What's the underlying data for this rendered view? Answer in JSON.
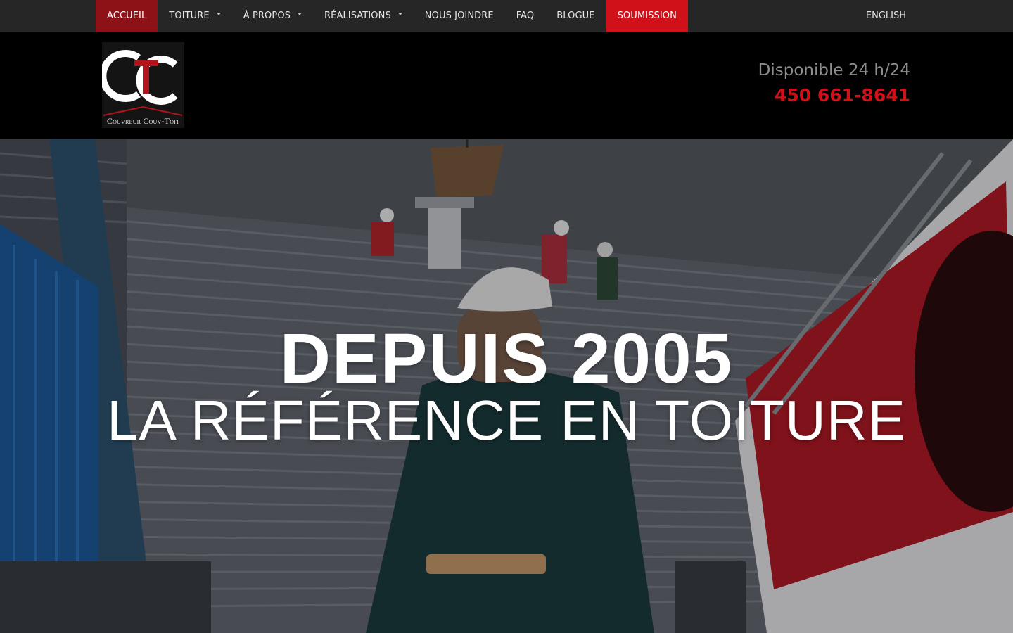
{
  "nav": {
    "items": [
      {
        "label": "ACCUEIL",
        "has_dropdown": false,
        "state": "active"
      },
      {
        "label": "TOITURE",
        "has_dropdown": true,
        "state": "normal"
      },
      {
        "label": "À PROPOS",
        "has_dropdown": true,
        "state": "normal"
      },
      {
        "label": "RÉALISATIONS",
        "has_dropdown": true,
        "state": "normal"
      },
      {
        "label": "NOUS JOINDRE",
        "has_dropdown": false,
        "state": "normal"
      },
      {
        "label": "FAQ",
        "has_dropdown": false,
        "state": "normal"
      },
      {
        "label": "BLOGUE",
        "has_dropdown": false,
        "state": "normal"
      },
      {
        "label": "SOUMISSION",
        "has_dropdown": false,
        "state": "highlighted"
      }
    ],
    "language_link": "ENGLISH"
  },
  "header": {
    "logo_letters": "CTC",
    "logo_caption": "Couvreur Couv-Toit",
    "availability": "Disponible 24 h/24",
    "phone": "450 661-8641"
  },
  "hero": {
    "title": "DEPUIS 2005",
    "subtitle": "LA RÉFÉRENCE EN TOITURE",
    "background_icon": "roofing-crew-photo"
  },
  "colors": {
    "nav_bg": "#262626",
    "active_bg": "#8c1217",
    "cta_bg": "#d0111a",
    "phone": "#d0111a",
    "header_bg": "#000000"
  }
}
